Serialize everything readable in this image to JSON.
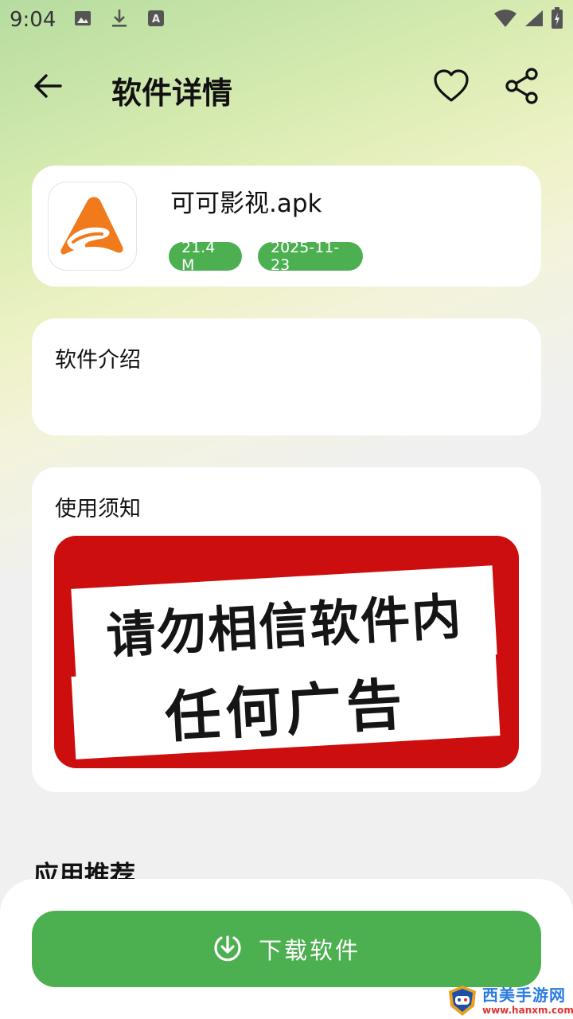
{
  "status_bar": {
    "time": "9:04",
    "icons_left": [
      "image-icon",
      "download-icon",
      "app-notification-icon"
    ],
    "icons_right": [
      "wifi-icon",
      "signal-icon",
      "battery-icon"
    ]
  },
  "header": {
    "title": "软件详情",
    "back_icon": "back-arrow-icon",
    "favorite_icon": "heart-icon",
    "share_icon": "share-icon"
  },
  "app": {
    "name": "可可影视.apk",
    "size": "21.4 M",
    "date": "2025-11-23",
    "icon_color": "#f07a1c"
  },
  "intro": {
    "label": "软件介绍"
  },
  "notice": {
    "label": "使用须知",
    "banner_line1": "请勿相信软件内",
    "banner_line2": "任何广告",
    "banner_color": "#cc0e0e"
  },
  "recommend": {
    "heading": "应用推荐"
  },
  "download": {
    "label": "下载软件",
    "icon": "download-circle-icon",
    "color": "#4caf50"
  },
  "watermark": {
    "title": "西美手游网",
    "url": "www.hanxm.com"
  }
}
